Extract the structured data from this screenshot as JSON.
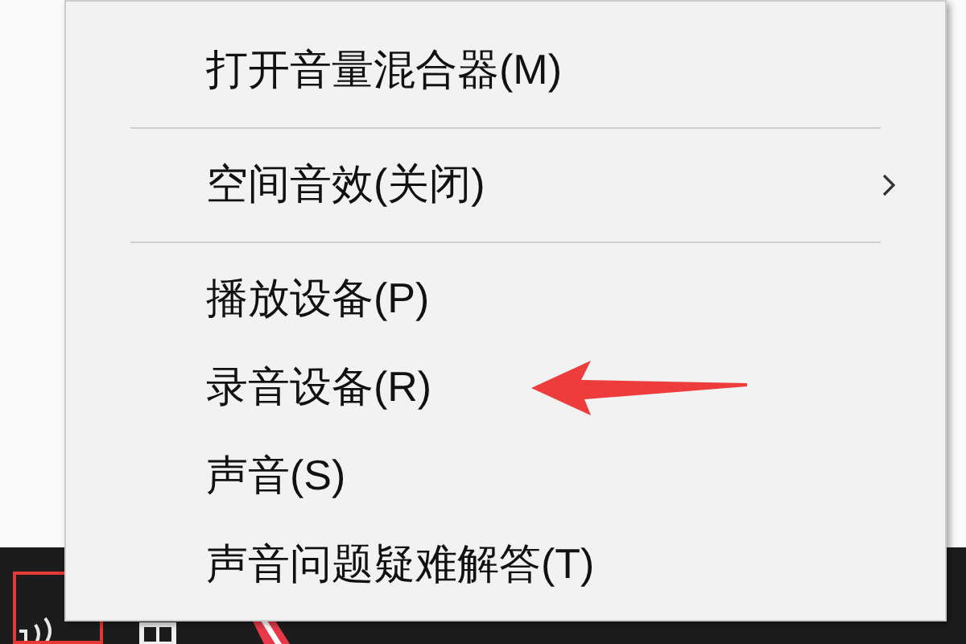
{
  "context_menu": {
    "items": [
      {
        "kind": "item",
        "label": "打开音量混合器(M)",
        "has_submenu": false
      },
      {
        "kind": "separator"
      },
      {
        "kind": "item",
        "label": "空间音效(关闭)",
        "has_submenu": true
      },
      {
        "kind": "separator"
      },
      {
        "kind": "item",
        "label": "播放设备(P)",
        "has_submenu": false
      },
      {
        "kind": "item",
        "label": "录音设备(R)",
        "has_submenu": false,
        "annotated": true
      },
      {
        "kind": "item",
        "label": "声音(S)",
        "has_submenu": false
      },
      {
        "kind": "item",
        "label": "声音问题疑难解答(T)",
        "has_submenu": false
      }
    ]
  },
  "taskbar": {
    "volume_icon_highlighted": true
  }
}
